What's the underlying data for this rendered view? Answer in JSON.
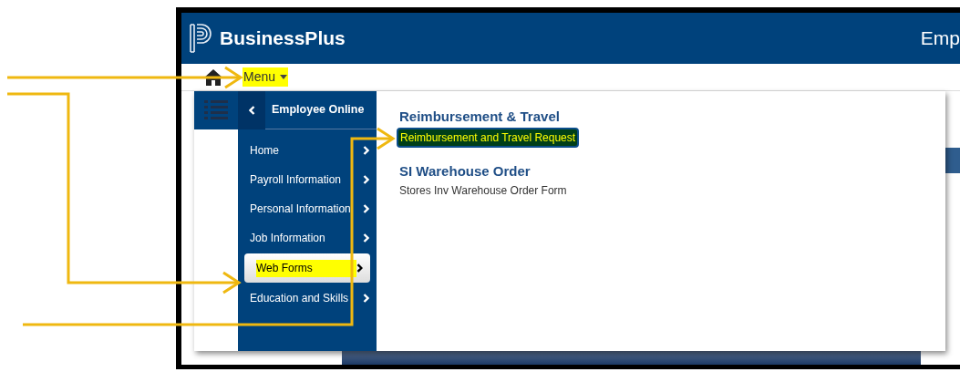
{
  "header": {
    "logo_text": "BusinessPlus",
    "title": "Emp"
  },
  "toolbar": {
    "menu_label": "Menu",
    "menu_highlighted": true
  },
  "menu": {
    "title": "Employee Online",
    "items": [
      {
        "label": "Home",
        "selected": false,
        "highlighted": false
      },
      {
        "label": "Payroll Information",
        "selected": false,
        "highlighted": false
      },
      {
        "label": "Personal Information",
        "selected": false,
        "highlighted": false
      },
      {
        "label": "Job Information",
        "selected": false,
        "highlighted": false
      },
      {
        "label": "Web Forms",
        "selected": true,
        "highlighted": true
      },
      {
        "label": "Education and Skills",
        "selected": false,
        "highlighted": false
      }
    ]
  },
  "sections": [
    {
      "title": "Reimbursement & Travel",
      "links": [
        {
          "label": "Reimbursement and Travel Request",
          "highlighted": true
        }
      ]
    },
    {
      "title": "SI Warehouse Order",
      "links": [
        {
          "label": "Stores Inv Warehouse Order Form",
          "highlighted": false
        }
      ]
    }
  ]
}
